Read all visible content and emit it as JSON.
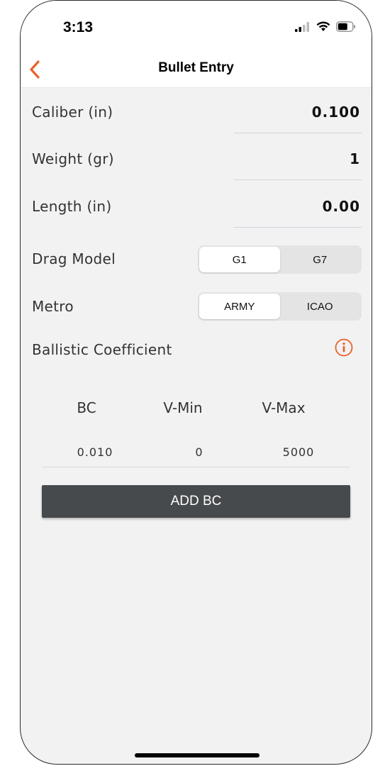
{
  "status_bar": {
    "time": "3:13",
    "icons": [
      "signal-icon",
      "wifi-icon",
      "battery-icon"
    ]
  },
  "nav": {
    "title": "Bullet Entry",
    "back_icon": "chevron-left-icon",
    "accent_color": "#e8622a"
  },
  "fields": {
    "caliber": {
      "label": "Caliber (in)",
      "value": "0.100"
    },
    "weight": {
      "label": "Weight (gr)",
      "value": "1"
    },
    "length": {
      "label": "Length (in)",
      "value": "0.00"
    }
  },
  "drag_model": {
    "label": "Drag Model",
    "options": [
      "G1",
      "G7"
    ],
    "selected": "G1"
  },
  "metro": {
    "label": "Metro",
    "options": [
      "ARMY",
      "ICAO"
    ],
    "selected": "ARMY"
  },
  "ballistic": {
    "title": "Ballistic Coefficient",
    "info_icon": "info-circle-icon",
    "headers": [
      "BC",
      "V-Min",
      "V-Max"
    ],
    "rows": [
      [
        "0.010",
        "0",
        "5000"
      ]
    ],
    "add_button": "ADD BC"
  }
}
